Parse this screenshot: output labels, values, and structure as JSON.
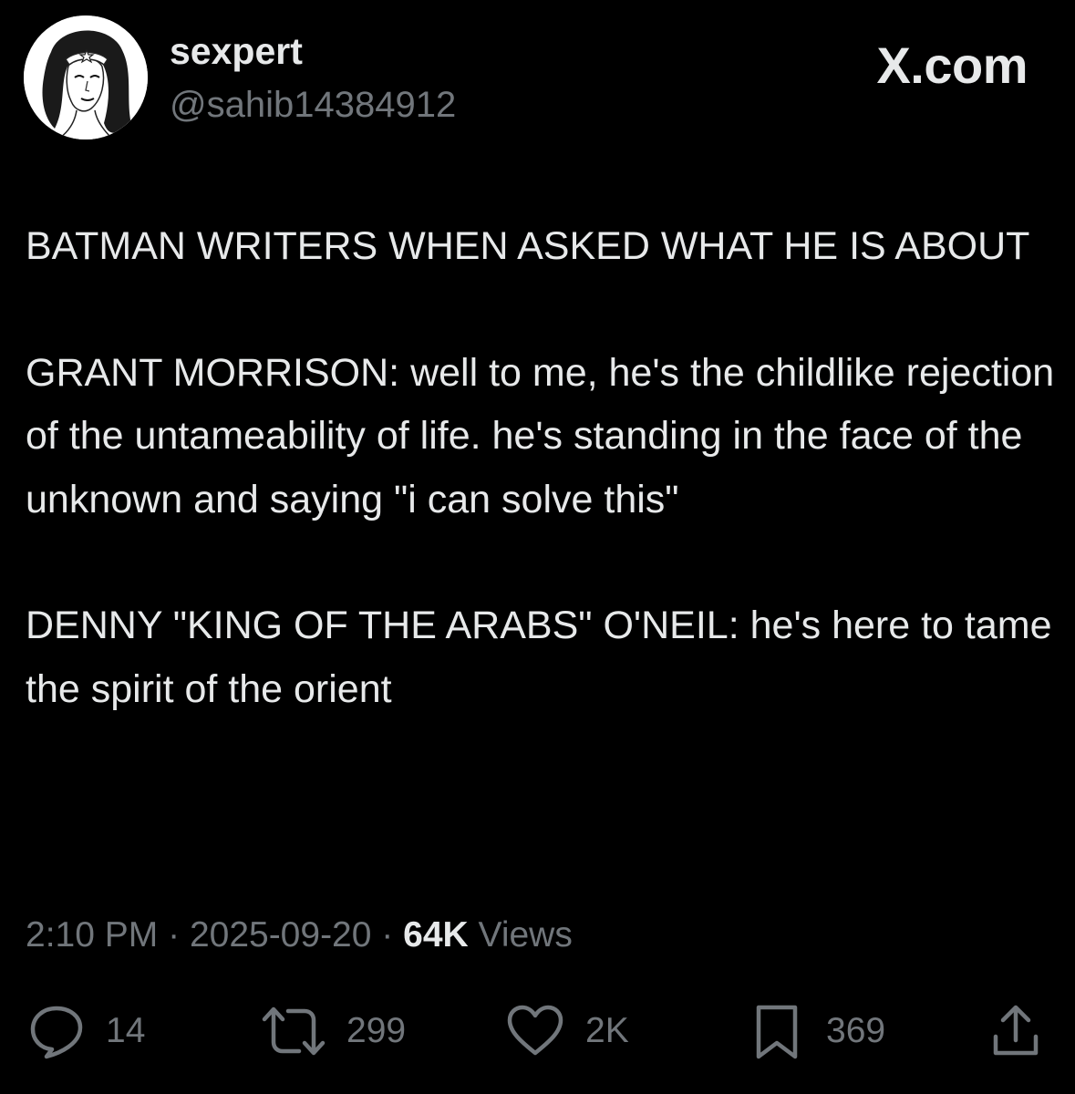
{
  "user": {
    "display_name": "sexpert",
    "handle": "@sahib14384912",
    "avatar_icon": "wonder-woman-portrait-avatar"
  },
  "brand": "X.com",
  "tweet": {
    "text": "BATMAN WRITERS WHEN ASKED WHAT HE IS ABOUT\n\nGRANT MORRISON: well to me, he's the childlike rejection of the untameability of life. he's standing in the face of the unknown and saying \"i can solve this\"\n\nDENNY \"KING OF THE ARABS\" O'NEIL: he's here to tame the spirit of the orient"
  },
  "meta": {
    "time": "2:10 PM",
    "separator": "·",
    "date": "2025-09-20",
    "views_count": "64K",
    "views_label": "Views"
  },
  "actions": {
    "replies": {
      "icon": "reply-icon",
      "count": "14"
    },
    "reposts": {
      "icon": "repost-icon",
      "count": "299"
    },
    "likes": {
      "icon": "heart-icon",
      "count": "2K"
    },
    "bookmarks": {
      "icon": "bookmark-icon",
      "count": "369"
    },
    "share": {
      "icon": "share-icon"
    }
  },
  "colors": {
    "background": "#000000",
    "primary_text": "#e7e9ea",
    "secondary_text": "#71767b"
  }
}
